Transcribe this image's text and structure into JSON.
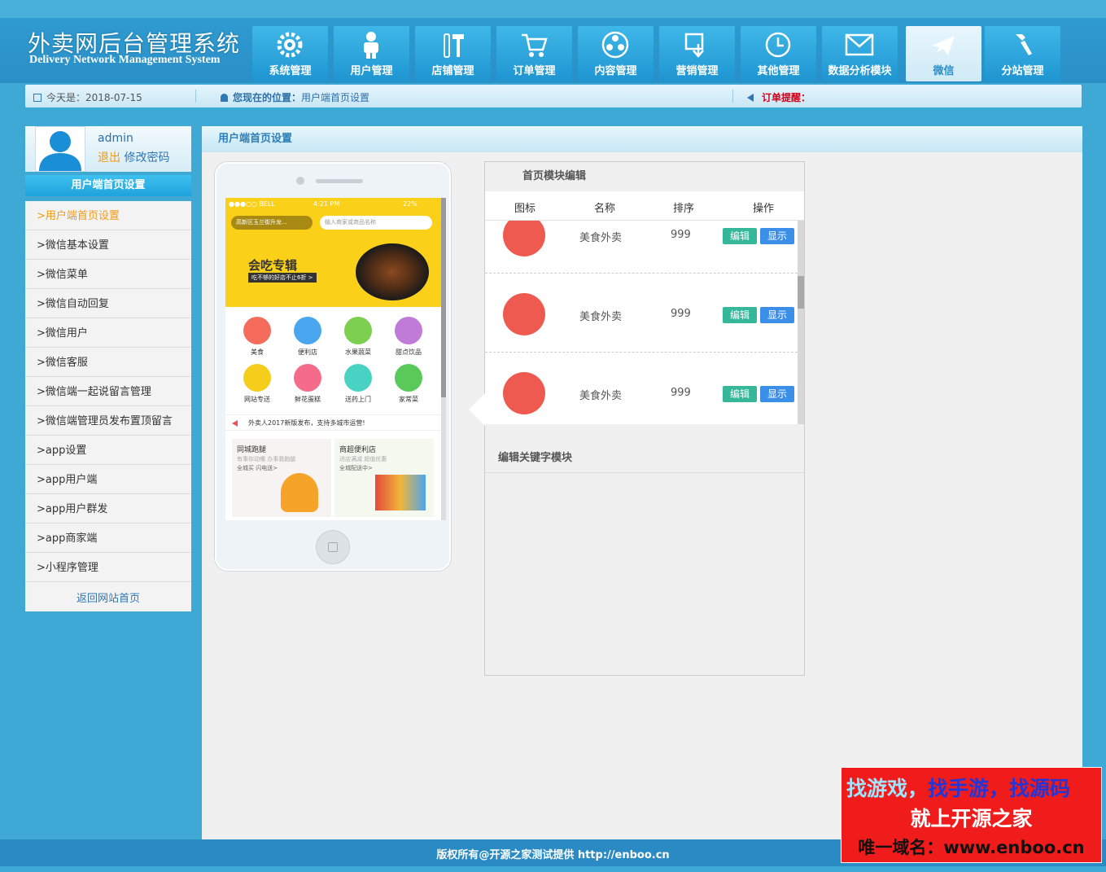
{
  "header": {
    "title_cn": "外卖网后台管理系统",
    "title_en": "Delivery Network Management System"
  },
  "nav": [
    {
      "label": "系统管理",
      "icon": "gear-icon"
    },
    {
      "label": "用户管理",
      "icon": "person-icon"
    },
    {
      "label": "店铺管理",
      "icon": "tools-icon"
    },
    {
      "label": "订单管理",
      "icon": "cart-icon"
    },
    {
      "label": "内容管理",
      "icon": "film-reel-icon"
    },
    {
      "label": "营销管理",
      "icon": "download-box-icon"
    },
    {
      "label": "其他管理",
      "icon": "clock-icon"
    },
    {
      "label": "数据分析模块",
      "icon": "mail-icon"
    },
    {
      "label": "微信",
      "icon": "plane-icon",
      "active": true
    },
    {
      "label": "分站管理",
      "icon": "wrench-icon"
    }
  ],
  "infobar": {
    "date_label": "今天是：",
    "date": "2018-07-15",
    "loc_label": "您现在的位置：",
    "loc": "用户端首页设置",
    "order_label": "订单提醒："
  },
  "user": {
    "name": "admin",
    "logout": "退出",
    "change_pwd": "修改密码"
  },
  "sidebar": {
    "title": "用户端首页设置",
    "items": [
      ">用户端首页设置",
      ">微信基本设置",
      ">微信菜单",
      ">微信自动回复",
      ">微信用户",
      ">微信客服",
      ">微信端一起说留言管理",
      ">微信端管理员发布置顶留言",
      ">app设置",
      ">app用户端",
      ">app用户群发",
      ">app商家端",
      ">小程序管理"
    ],
    "back": "返回网站首页"
  },
  "main": {
    "title": "用户端首页设置"
  },
  "phone": {
    "carrier": "●●●○○ BELL",
    "time": "4:21 PM",
    "battery": "22%",
    "location": "高新区玉兰街升龙...",
    "search_ph": "输入商家或商品名称",
    "banner_title": "会吃专辑",
    "banner_sub": "吃不够的好店不止6折 >",
    "grid": [
      {
        "label": "美食",
        "color": "#f56c5c"
      },
      {
        "label": "便利店",
        "color": "#4aa6ee"
      },
      {
        "label": "水果蔬菜",
        "color": "#7dd04f"
      },
      {
        "label": "甜点饮品",
        "color": "#c07ad8"
      },
      {
        "label": "网站专送",
        "color": "#f6cd1a"
      },
      {
        "label": "鲜花蛋糕",
        "color": "#f56c8a"
      },
      {
        "label": "送药上门",
        "color": "#48d2c4"
      },
      {
        "label": "家常菜",
        "color": "#59c95a"
      }
    ],
    "notice": "外卖人2017新版发布，支持多城市运营!",
    "card1": {
      "title": "同城跑腿",
      "sub": "有事你动嘴 办事我跑腿",
      "tag": "全城买 闪电送>"
    },
    "card2": {
      "title": "商超便利店",
      "sub": "进店满减 超值优惠",
      "tag": "全城配送中>"
    }
  },
  "panel": {
    "title": "首页模块编辑",
    "cols": [
      "图标",
      "名称",
      "排序",
      "操作"
    ],
    "rows": [
      {
        "name": "美食外卖",
        "order": "999",
        "edit": "编辑",
        "show": "显示"
      },
      {
        "name": "美食外卖",
        "order": "999",
        "edit": "编辑",
        "show": "显示"
      },
      {
        "name": "美食外卖",
        "order": "999",
        "edit": "编辑",
        "show": "显示"
      }
    ],
    "kw_title": "编辑关键字模块"
  },
  "footer": {
    "text": "版权所有@开源之家测试提供 http://enboo.cn"
  },
  "watermark": {
    "line1a": "找游戏，",
    "line1b": "找手游，找源码",
    "line2": "就上开源之家",
    "line3": "唯一域名：www.enboo.cn"
  }
}
